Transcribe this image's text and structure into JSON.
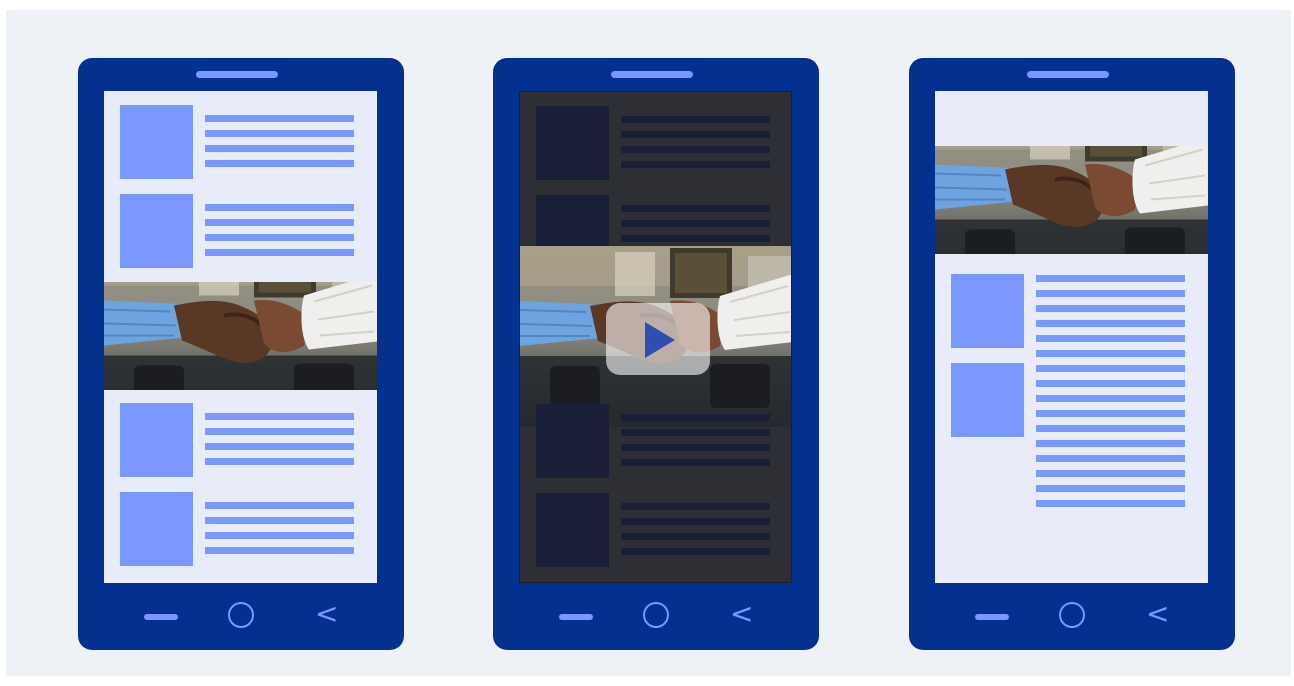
{
  "colors": {
    "stage": "#eef1f6",
    "phone_body": "#04318f",
    "accent": "#7a98ff",
    "screen_light": "#e8ecf8",
    "screen_dark": "#2d2f35",
    "placeholder_dark": "#1a1f38"
  },
  "phones": [
    {
      "name": "phone-inline-image",
      "theme": "light",
      "image": "handshake-photo"
    },
    {
      "name": "phone-video-overlay",
      "theme": "dark",
      "image": "handshake-photo",
      "overlay": "play-icon"
    },
    {
      "name": "phone-header-image",
      "theme": "light",
      "image": "handshake-photo"
    }
  ],
  "navigation": {
    "icons": [
      "menu-icon",
      "home-icon",
      "back-icon"
    ],
    "back_glyph": "<"
  }
}
